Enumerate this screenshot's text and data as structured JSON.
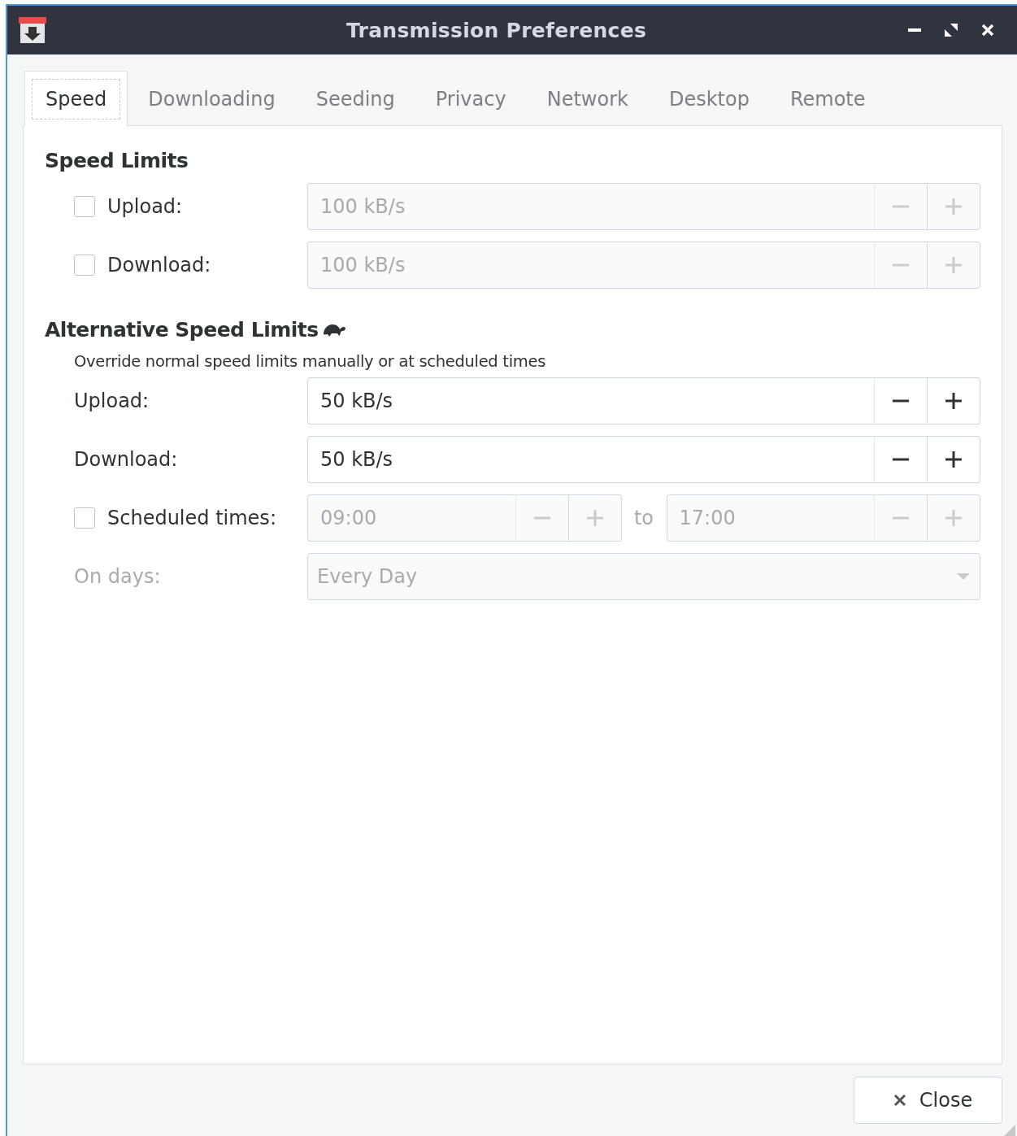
{
  "window": {
    "title": "Transmission Preferences"
  },
  "tabs": [
    {
      "label": "Speed",
      "selected": true
    },
    {
      "label": "Downloading",
      "selected": false
    },
    {
      "label": "Seeding",
      "selected": false
    },
    {
      "label": "Privacy",
      "selected": false
    },
    {
      "label": "Network",
      "selected": false
    },
    {
      "label": "Desktop",
      "selected": false
    },
    {
      "label": "Remote",
      "selected": false
    }
  ],
  "speed_limits": {
    "title": "Speed Limits",
    "rows": [
      {
        "label": "Upload:",
        "checked": false,
        "value": "100 kB/s"
      },
      {
        "label": "Download:",
        "checked": false,
        "value": "100 kB/s"
      }
    ]
  },
  "alt_speed_limits": {
    "title": "Alternative Speed Limits",
    "description": "Override normal speed limits manually or at scheduled times",
    "rows": [
      {
        "label": "Upload:",
        "value": "50 kB/s"
      },
      {
        "label": "Download:",
        "value": "50 kB/s"
      }
    ],
    "scheduled": {
      "label": "Scheduled times:",
      "checked": false,
      "from": "09:00",
      "separator": "to",
      "to": "17:00"
    },
    "on_days": {
      "label": "On days:",
      "value": "Every Day",
      "disabled": true
    }
  },
  "buttons": [
    {
      "label": "Close"
    }
  ]
}
